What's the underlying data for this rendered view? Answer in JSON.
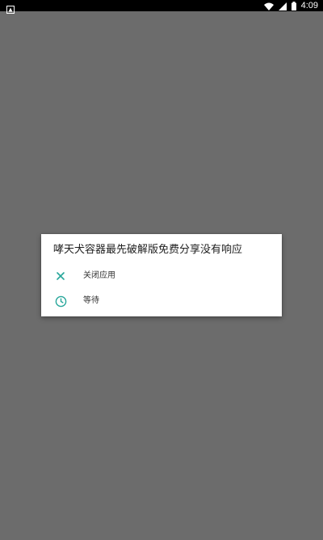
{
  "status_bar": {
    "time": "4:09",
    "icons": [
      "notification-icon",
      "wifi-icon",
      "cell-signal-icon",
      "battery-icon"
    ]
  },
  "dialog": {
    "title": "哮天犬容器最先破解版免费分享没有响应",
    "options": [
      {
        "label": "关闭应用",
        "icon": "close-icon"
      },
      {
        "label": "等待",
        "icon": "clock-icon"
      }
    ]
  },
  "colors": {
    "accent": "#26a69a",
    "scrim": "#6c6c6c",
    "status_bar": "#000000",
    "dialog_bg": "#ffffff"
  }
}
